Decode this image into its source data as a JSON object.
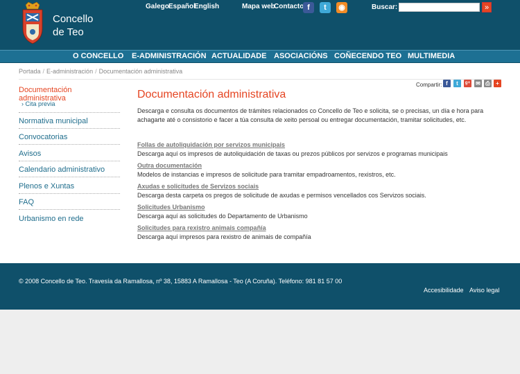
{
  "header": {
    "brand_line1": "Concello",
    "brand_line2": "de Teo",
    "languages": [
      "Galego",
      "Español",
      "English"
    ],
    "top_links": [
      "Mapa web",
      "Contacto"
    ],
    "social": [
      {
        "icon": "facebook-icon",
        "glyph": "f",
        "color": "#3b5998"
      },
      {
        "icon": "twitter-icon",
        "glyph": "t",
        "color": "#3fa9d8"
      },
      {
        "icon": "rss-icon",
        "glyph": "◉",
        "color": "#f28c26"
      }
    ],
    "search_label": "Buscar:",
    "search_value": "",
    "search_button": "»"
  },
  "nav": [
    "O CONCELLO",
    "E-ADMINISTRACIÓN",
    "ACTUALIDADE",
    "ASOCIACIÓNS",
    "COÑECENDO TEO",
    "MULTIMEDIA"
  ],
  "breadcrumb": [
    "Portada",
    "E-administración",
    "Documentación administrativa"
  ],
  "breadcrumb_sep": "/",
  "sidebar": {
    "active": "Documentación administrativa",
    "sub_marker": "›",
    "sub_item": "Cita previa",
    "items": [
      "Normativa municipal",
      "Convocatorias",
      "Avisos",
      "Calendario administrativo",
      "Plenos e Xuntas",
      "FAQ",
      "Urbanismo en rede"
    ]
  },
  "share": {
    "label": "Compartir:",
    "icons": [
      {
        "icon": "facebook-icon",
        "glyph": "f",
        "color": "#3b5998"
      },
      {
        "icon": "twitter-icon",
        "glyph": "t",
        "color": "#3fa9d8"
      },
      {
        "icon": "google-plus-icon",
        "glyph": "g+",
        "color": "#dd4b39"
      },
      {
        "icon": "email-icon",
        "glyph": "✉",
        "color": "#888888"
      },
      {
        "icon": "print-icon",
        "glyph": "⎙",
        "color": "#888888"
      },
      {
        "icon": "more-icon",
        "glyph": "+",
        "color": "#e54522"
      }
    ]
  },
  "main": {
    "title": "Documentación administrativa",
    "intro": "Descarga e consulta os documentos de trámites relacionados co Concello de Teo e solicita, se o precisas, un día e hora para achagarte até o consistorio e facer a túa consulta de xeito persoal ou entregar documentación, tramitar solicitudes, etc.",
    "entries": [
      {
        "title": "Follas de autoliquidación por servizos municipais",
        "desc": "Descarga aquí os impresos de autoliquidación de taxas ou prezos públicos por servizos e programas municipais"
      },
      {
        "title": "Outra documentación",
        "desc": "Modelos de instancias e impresos de solicitude para tramitar empadroamentos, rexistros, etc."
      },
      {
        "title": "Axudas e solicitudes de Servizos sociais",
        "desc": "Descarga desta carpeta os pregos de solicitude de axudas e permisos vencellados cos Servizos sociais."
      },
      {
        "title": "Solicitudes Urbanismo",
        "desc": "Descarga aquí as solicitudes do Departamento de Urbanismo"
      },
      {
        "title": "Solicitudes para rexistro animais compañía",
        "desc": "Descarga aquí impresos para rexistro de animais de compañía"
      }
    ]
  },
  "footer": {
    "text": "© 2008 Concello de Teo. Travesía da Ramallosa, nº 38, 15883 A Ramallosa - Teo (A Coruña). Teléfono: 981 81 57 00",
    "links": [
      "Accesibilidade",
      "Aviso legal"
    ]
  }
}
